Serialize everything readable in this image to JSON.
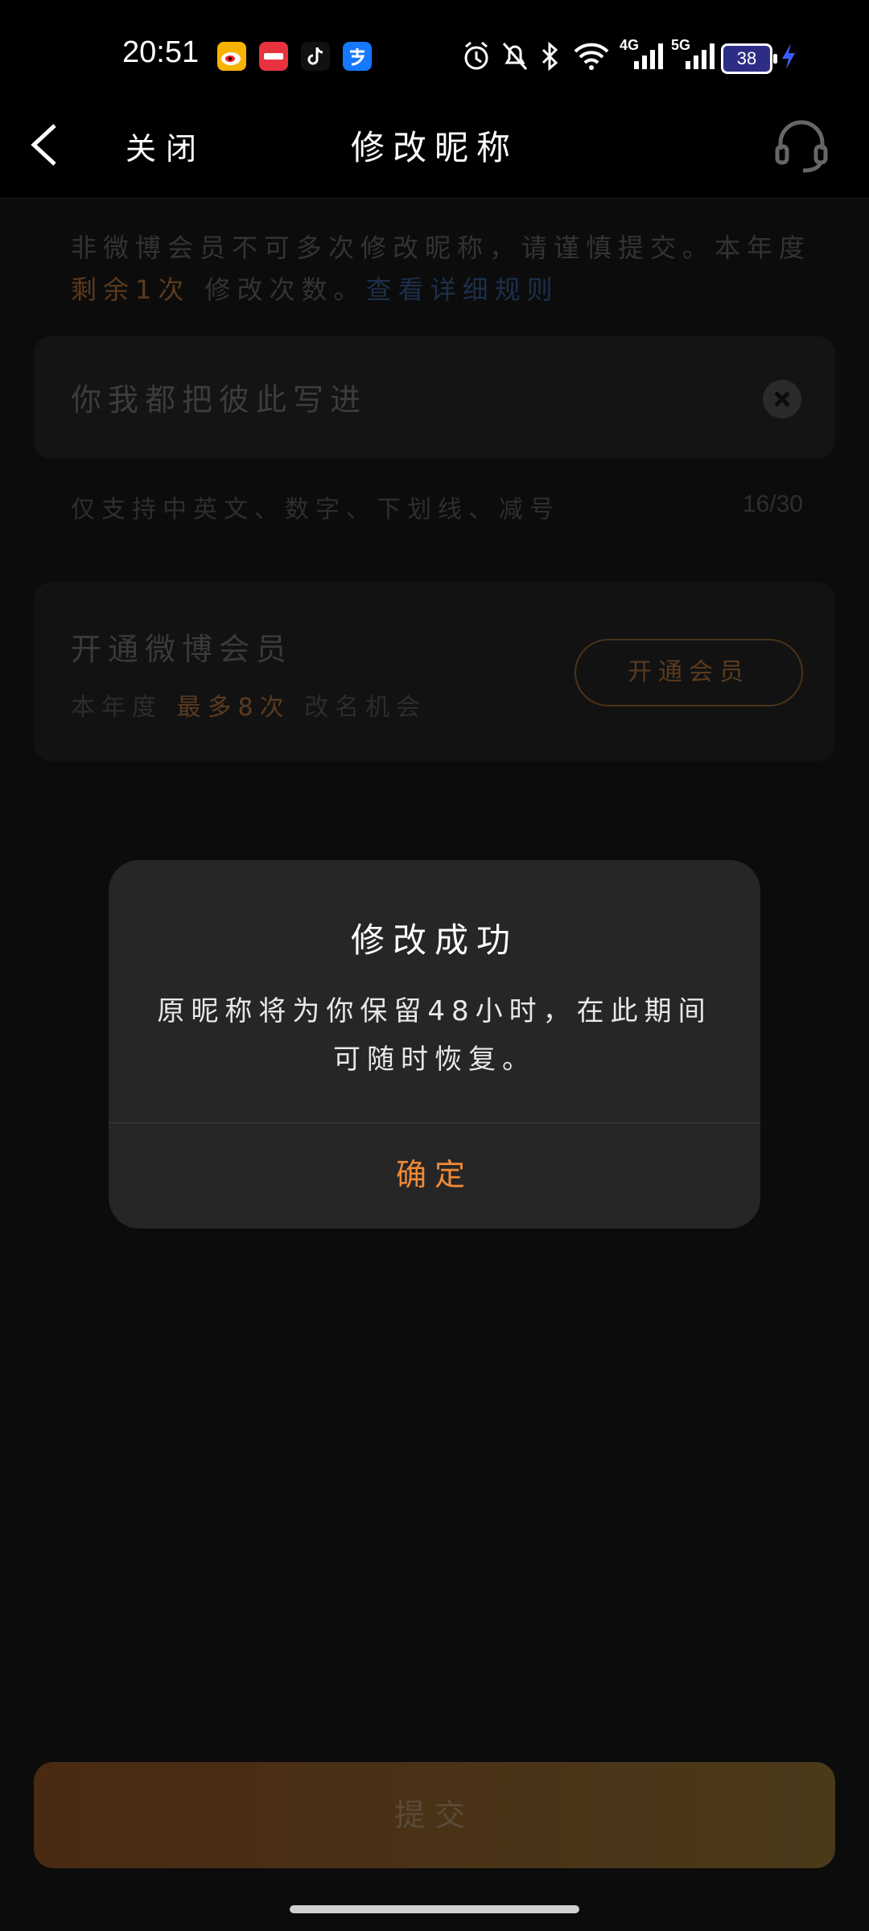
{
  "status_bar": {
    "time": "20:51",
    "app_icons": [
      "weibo-icon",
      "xiaohongshu-icon",
      "tiktok-icon",
      "alipay-icon"
    ],
    "indicators": [
      "alarm-icon",
      "mute-icon",
      "bluetooth-icon",
      "wifi-icon"
    ],
    "signal1": "4G",
    "signal2": "5G",
    "battery": "38"
  },
  "nav": {
    "close_label": "关闭",
    "title": "修改昵称"
  },
  "notice": {
    "text1": "非微博会员不可多次修改昵称，请谨慎提交。本年度",
    "remaining": "剩余1次",
    "text2": "修改次数。",
    "rules_link": "查看详细规则"
  },
  "nickname_input": {
    "value": "你我都把彼此写进",
    "clear_icon": "close-icon"
  },
  "input_hint": "仅支持中英文、数字、下划线、减号",
  "input_counter": "16/30",
  "vip": {
    "title": "开通微博会员",
    "sub1": "本年度",
    "sub_highlight": "最多8次",
    "sub2": "改名机会",
    "button": "开通会员"
  },
  "modal": {
    "title": "修改成功",
    "body": "原昵称将为你保留48小时，在此期间可随时恢复。",
    "confirm": "确定"
  },
  "submit_label": "提交",
  "colors": {
    "accent": "#f08a35",
    "background": "#0c0c0c",
    "modal": "#262626"
  }
}
